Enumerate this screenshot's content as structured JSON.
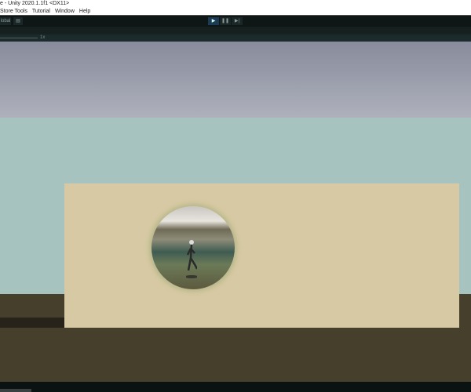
{
  "window": {
    "title": "e - Unity 2020.1.1f1 <DX11>"
  },
  "menu": {
    "items": [
      "Store Tools",
      "Tutorial",
      "Window",
      "Help"
    ]
  },
  "toolbar": {
    "global_label": "lobal",
    "play_icon": "play-icon",
    "pause_icon": "pause-icon",
    "step_icon": "step-icon"
  },
  "timescale": {
    "label": "1x"
  },
  "colors": {
    "sky": "#878b9b",
    "horizon": "#a6c3bf",
    "ground": "#453f2c",
    "wall": "#d6c9a3",
    "toolbar": "#0e1716",
    "play_active": "#1d3a55"
  }
}
